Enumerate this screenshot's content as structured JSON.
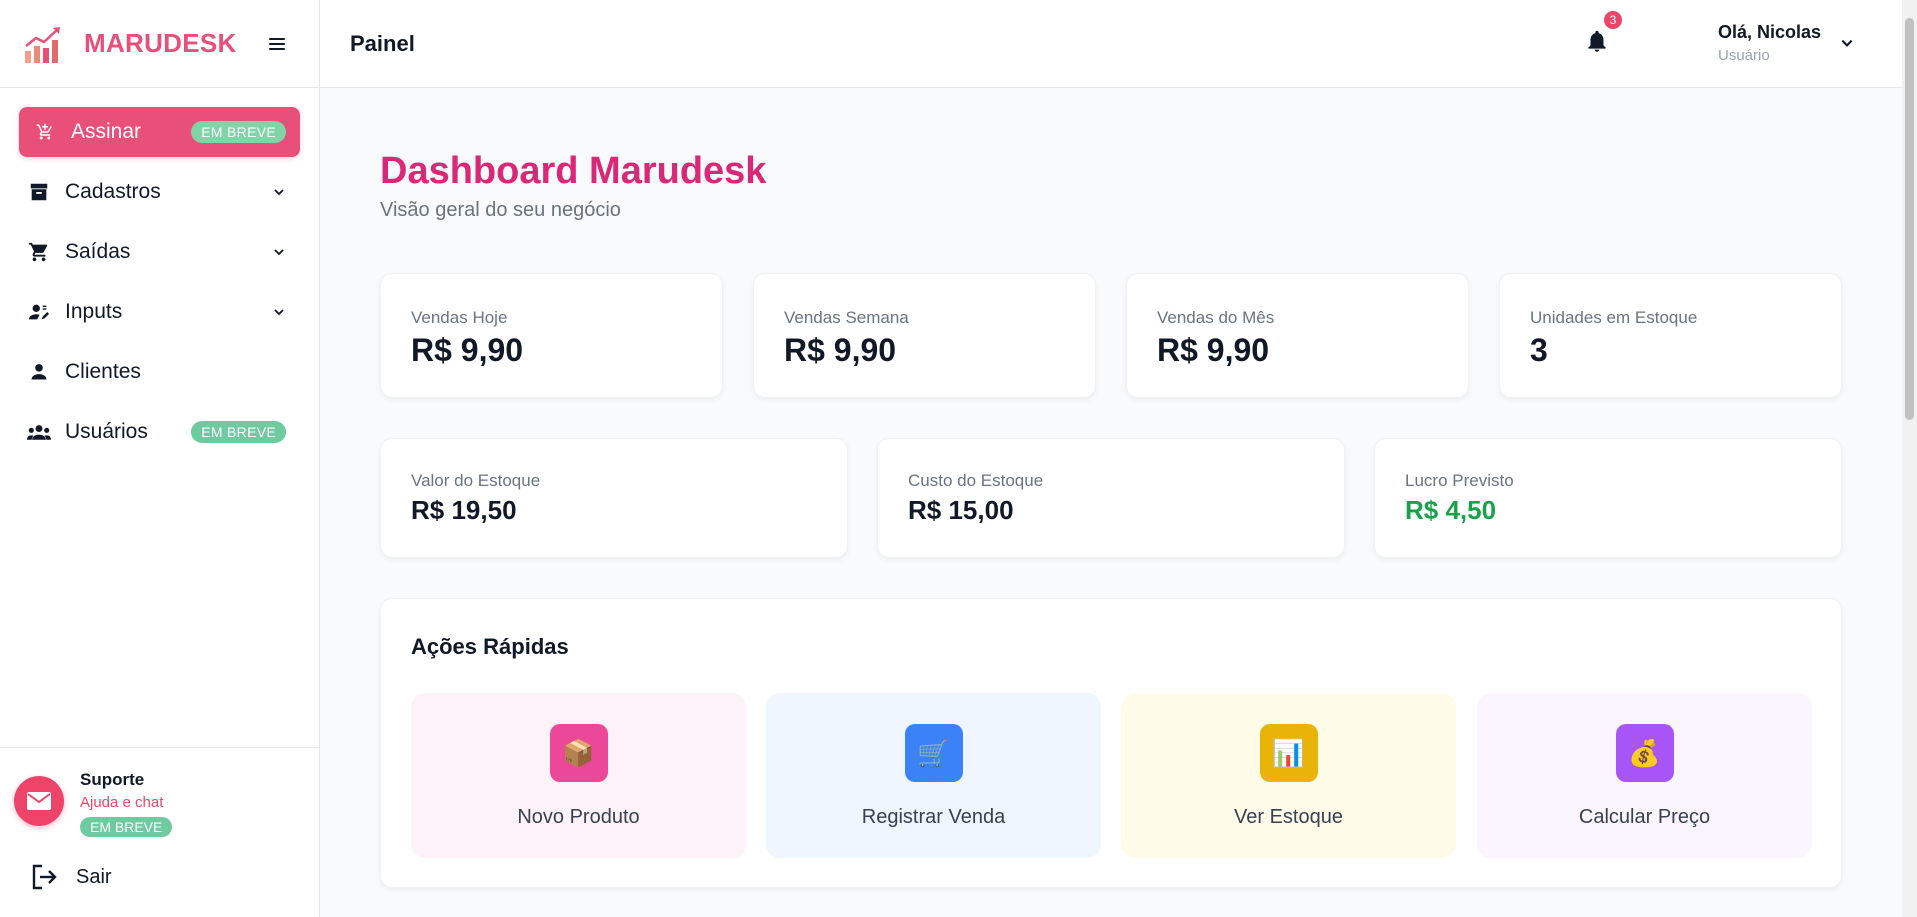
{
  "brand": {
    "name": "MARUDESK"
  },
  "sidebar": {
    "items": [
      {
        "label": "Assinar",
        "badge": "EM BREVE",
        "icon": "cart-plus-icon"
      },
      {
        "label": "Cadastros",
        "icon": "archive-icon"
      },
      {
        "label": "Saídas",
        "icon": "cart-icon"
      },
      {
        "label": "Inputs",
        "icon": "user-edit-icon"
      },
      {
        "label": "Clientes",
        "icon": "user-icon"
      },
      {
        "label": "Usuários",
        "badge": "EM BREVE",
        "icon": "users-icon"
      }
    ],
    "support": {
      "title": "Suporte",
      "subtitle": "Ajuda e chat",
      "badge": "EM BREVE"
    },
    "logout": {
      "label": "Sair"
    }
  },
  "header": {
    "title": "Painel",
    "notifications": "3",
    "user": {
      "greeting": "Olá, Nicolas",
      "role": "Usuário"
    }
  },
  "main": {
    "title": "Dashboard Marudesk",
    "subtitle": "Visão geral do seu negócio",
    "stats_row1": [
      {
        "label": "Vendas Hoje",
        "value": "R$ 9,90"
      },
      {
        "label": "Vendas Semana",
        "value": "R$ 9,90"
      },
      {
        "label": "Vendas do Mês",
        "value": "R$ 9,90"
      },
      {
        "label": "Unidades em Estoque",
        "value": "3"
      }
    ],
    "stats_row2": [
      {
        "label": "Valor do Estoque",
        "value": "R$ 19,50"
      },
      {
        "label": "Custo do Estoque",
        "value": "R$ 15,00"
      },
      {
        "label": "Lucro Previsto",
        "value": "R$ 4,50"
      }
    ],
    "quick_actions": {
      "title": "Ações Rápidas",
      "items": [
        {
          "label": "Novo Produto",
          "icon": "package-icon",
          "glyph": "📦",
          "bg": "#fdf2f8",
          "icon_bg": "#ec4899"
        },
        {
          "label": "Registrar Venda",
          "icon": "shopping-cart-icon",
          "glyph": "🛒",
          "bg": "#eff6ff",
          "icon_bg": "#3b82f6"
        },
        {
          "label": "Ver Estoque",
          "icon": "bar-chart-icon",
          "glyph": "📊",
          "bg": "#fefce8",
          "icon_bg": "#eab308"
        },
        {
          "label": "Calcular Preço",
          "icon": "money-bag-icon",
          "glyph": "💰",
          "bg": "#faf5ff",
          "icon_bg": "#a855f7"
        }
      ]
    }
  },
  "colors": {
    "brand": "#e8507a",
    "title": "#db2777",
    "profit": "#16a34a",
    "badge": "#6fcaa0"
  }
}
